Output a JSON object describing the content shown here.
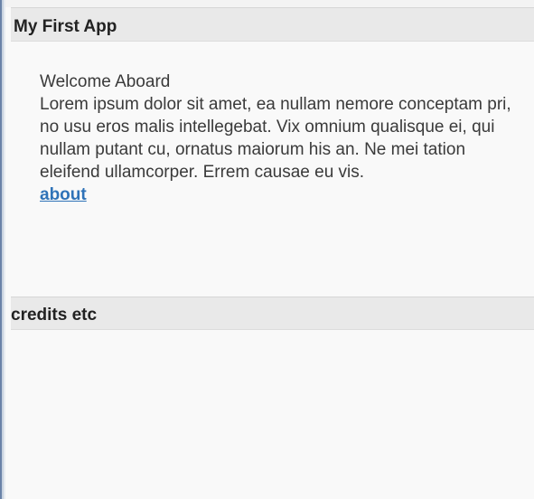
{
  "header": {
    "title": "My First App"
  },
  "main": {
    "heading": "Welcome Aboard",
    "body": "Lorem ipsum dolor sit amet, ea nullam nemore conceptam pri, no usu eros malis intellegebat. Vix omnium qualisque ei, qui nullam putant cu, ornatus maiorum his an. Ne mei tation eleifend ullamcorper. Errem causae eu vis.",
    "link_label": "about"
  },
  "footer": {
    "title": "credits etc"
  },
  "colors": {
    "link": "#2f73b8",
    "bar_background": "#e9e9e9",
    "page_background": "#f9f9f9",
    "text": "#3a3a3a"
  }
}
